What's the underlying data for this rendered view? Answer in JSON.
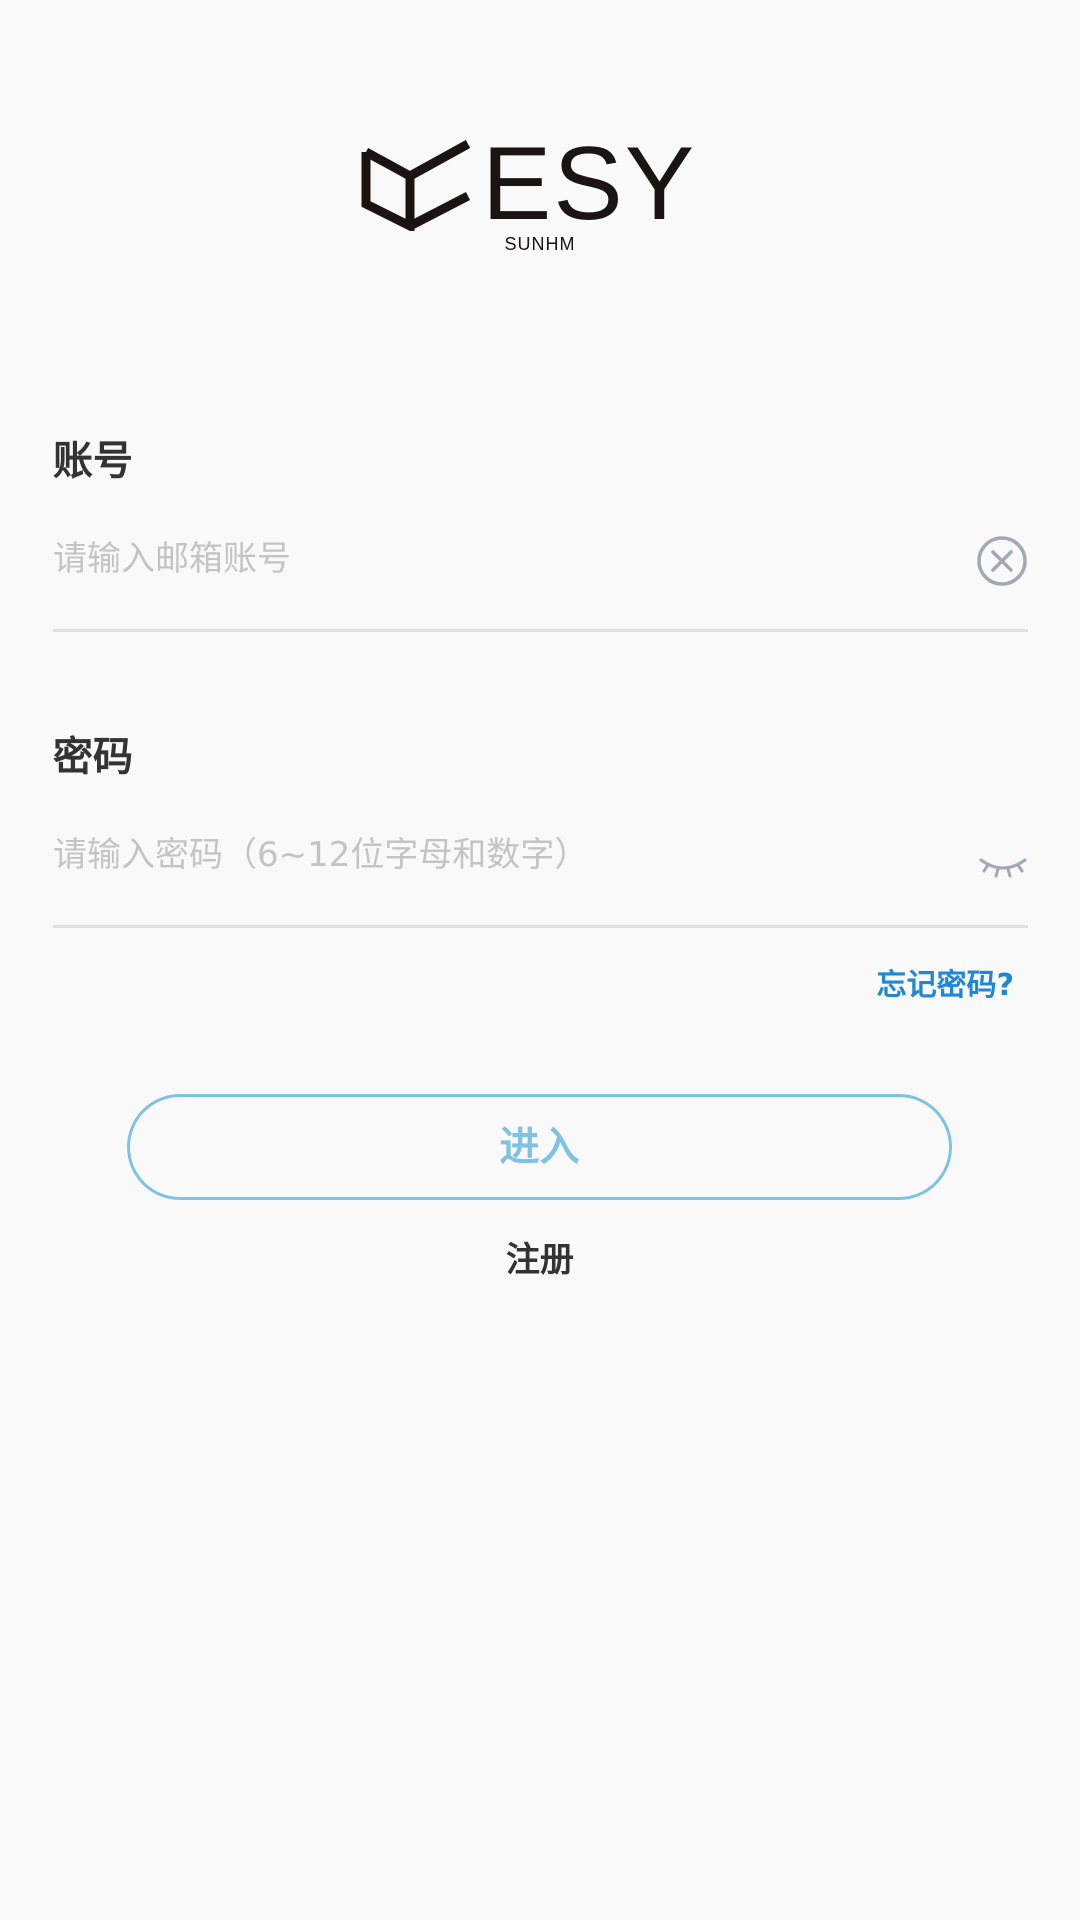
{
  "logo": {
    "text": "ESY",
    "subtitle": "SUNHM"
  },
  "account": {
    "label": "账号",
    "placeholder": "请输入邮箱账号",
    "value": "",
    "clear_icon": "clear-circle-icon"
  },
  "password": {
    "label": "密码",
    "placeholder": "请输入密码（6~12位字母和数字）",
    "value": "",
    "visibility_icon": "eye-closed-icon"
  },
  "forgot_label": "忘记密码?",
  "enter_label": "进入",
  "register_label": "注册",
  "colors": {
    "background": "#f9f9f9",
    "accent": "#1f87d6",
    "button_border": "#7ec2e4",
    "label": "#333333",
    "placeholder": "#c4c4c4",
    "divider": "#e1e1e1"
  }
}
